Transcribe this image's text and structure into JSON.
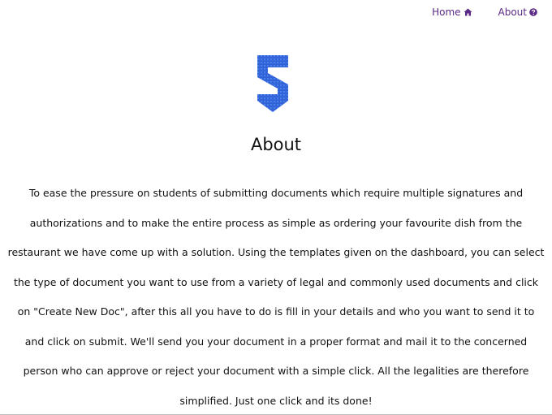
{
  "nav": {
    "home_label": "Home",
    "about_label": "About",
    "home_icon": "home-icon",
    "about_icon": "question-circle-icon"
  },
  "logo": {
    "icon": "s-shield-logo",
    "colors": [
      "#1e40c8",
      "#2f6be8",
      "#4d8af5"
    ]
  },
  "page": {
    "title": "About",
    "body": "To ease the pressure on students of submitting documents which require multiple signatures and authorizations and to make the entire process as simple as ordering your favourite dish from the restaurant we have come up with a solution. Using the templates given on the dashboard, you can select the type of document you want to use from a variety of legal and commonly used documents and click on \"Create New Doc\", after this all you have to do is fill in your details and who you want to send it to and click on submit. We'll send you your document in a proper format and mail it to the concerned person who can approve or reject your document with a simple click. All the legalities are therefore simplified. Just one click and its done!"
  },
  "colors": {
    "nav_link": "#5b2a86",
    "text": "#111111",
    "background": "#ffffff"
  }
}
